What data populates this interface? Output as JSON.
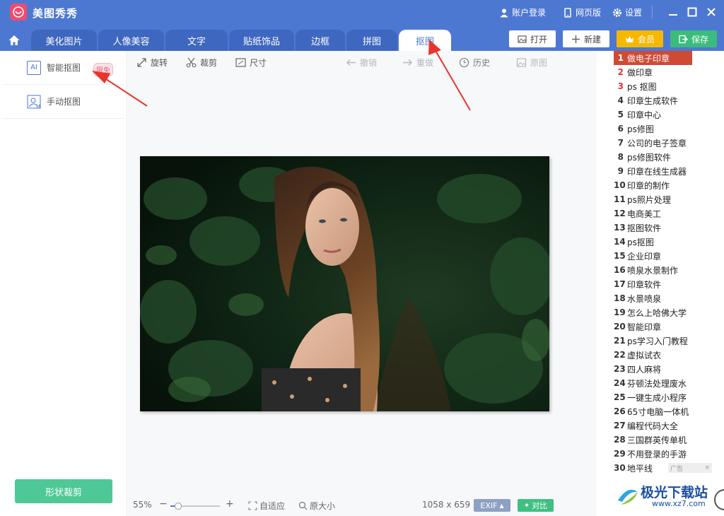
{
  "app": {
    "title": "美图秀秀"
  },
  "titlebar": {
    "account": "账户登录",
    "web": "网页版",
    "settings": "设置"
  },
  "tabs": [
    "美化图片",
    "人像美容",
    "文字",
    "贴纸饰品",
    "边框",
    "拼图",
    "抠图"
  ],
  "active_tab": "抠图",
  "header_buttons": {
    "open": "打开",
    "new": "新建",
    "vip": "会员",
    "save": "保存"
  },
  "left_panel": {
    "smart_cutout": "智能抠图",
    "smart_icon": "AI",
    "free_badge": "限免",
    "manual_cutout": "手动抠图",
    "shape_crop": "形状裁剪"
  },
  "toolbar": {
    "rotate": "旋转",
    "crop": "裁剪",
    "size": "尺寸",
    "undo": "撤销",
    "redo": "重做",
    "history": "历史",
    "original": "原图"
  },
  "bottom": {
    "zoom": "55%",
    "zoom_level": 0.15,
    "fit": "自适应",
    "actual": "原大小",
    "dimensions": "1058 x 659",
    "exif": "EXIF",
    "compare": "对比"
  },
  "ranking": [
    "做电子印章",
    "做印章",
    "ps 抠图",
    "印章生成软件",
    "印章中心",
    "ps修图",
    "公司的电子签章",
    "ps修图软件",
    "印章在线生成器",
    "印章的制作",
    "ps照片处理",
    "电商美工",
    "抠图软件",
    "ps抠图",
    "企业印章",
    "喷泉水景制作",
    "印章软件",
    "水景喷泉",
    "怎么上哈佛大学",
    "智能印章",
    "ps学习入门教程",
    "虚拟试衣",
    "四人麻将",
    "芬顿法处理废水",
    "一键生成小程序",
    "65寸电脑一体机",
    "编程代码大全",
    "三国群英传单机",
    "不用登录的手游",
    "地平线"
  ],
  "ad": {
    "label": "广告",
    "close": "×"
  },
  "watermark": {
    "title": "极光下载站",
    "url": "www.xz7.com"
  },
  "colors": {
    "brand": "#4d78d2",
    "tab_dark": "#3e67c0",
    "vip": "#f5b800",
    "save": "#3bbc7c",
    "shape_crop": "#4ec996",
    "rank_first": "#cf4a35",
    "arrow": "#e8352a"
  }
}
